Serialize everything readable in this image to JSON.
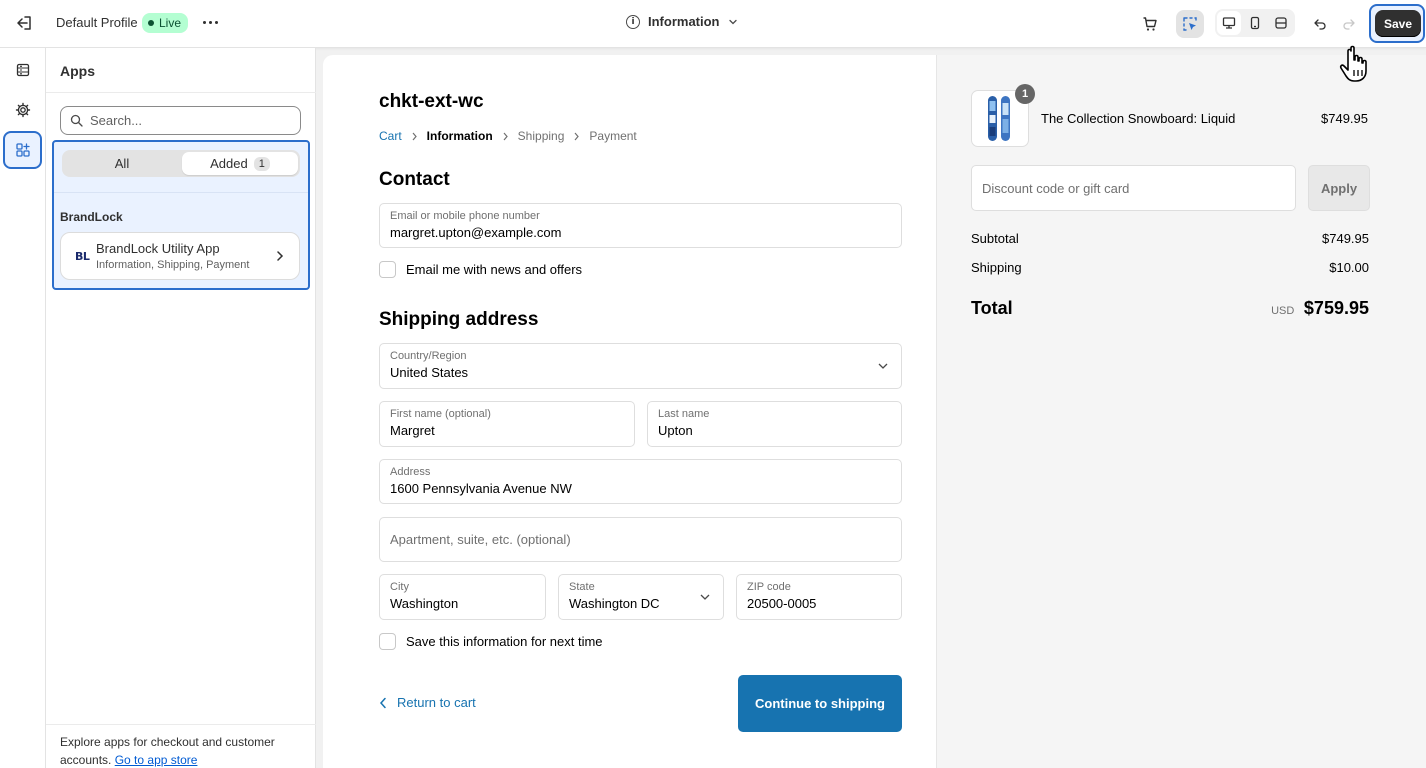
{
  "topbar": {
    "profile_name": "Default Profile",
    "status_badge": "Live",
    "page_selector": "Information",
    "save_label": "Save"
  },
  "panel": {
    "title": "Apps",
    "search_placeholder": "Search...",
    "tabs": [
      {
        "label": "All",
        "count": ""
      },
      {
        "label": "Added",
        "count": "1"
      }
    ],
    "group_label": "BrandLock",
    "app": {
      "logo_text": "BL",
      "name": "BrandLock Utility App",
      "targets": "Information, Shipping, Payment"
    },
    "footer_text": "Explore apps for checkout and customer accounts.",
    "footer_link": "Go to app store"
  },
  "checkout": {
    "shop_name": "chkt-ext-wc",
    "breadcrumbs": [
      "Cart",
      "Information",
      "Shipping",
      "Payment"
    ],
    "contact_heading": "Contact",
    "email": {
      "label": "Email or mobile phone number",
      "value": "margret.upton@example.com"
    },
    "news_checkbox": "Email me with news and offers",
    "shipping_heading": "Shipping address",
    "country": {
      "label": "Country/Region",
      "value": "United States"
    },
    "first_name": {
      "label": "First name (optional)",
      "value": "Margret"
    },
    "last_name": {
      "label": "Last name",
      "value": "Upton"
    },
    "address": {
      "label": "Address",
      "value": "1600 Pennsylvania Avenue NW"
    },
    "apartment_placeholder": "Apartment, suite, etc. (optional)",
    "city": {
      "label": "City",
      "value": "Washington"
    },
    "state": {
      "label": "State",
      "value": "Washington DC"
    },
    "zip": {
      "label": "ZIP code",
      "value": "20500-0005"
    },
    "save_info_checkbox": "Save this information for next time",
    "return_link": "Return to cart",
    "continue_button": "Continue to shipping"
  },
  "summary": {
    "quantity": "1",
    "product_name": "The Collection Snowboard: Liquid",
    "product_price": "$749.95",
    "discount_placeholder": "Discount code or gift card",
    "apply_label": "Apply",
    "subtotal_label": "Subtotal",
    "subtotal_value": "$749.95",
    "shipping_label": "Shipping",
    "shipping_value": "$10.00",
    "total_label": "Total",
    "currency": "USD",
    "total_value": "$759.95"
  },
  "colors": {
    "accent": "#2c6ecb",
    "checkout_primary": "#1773b0",
    "live_badge": "#b4fed2",
    "save_button": "#303030"
  },
  "icons": [
    "exit-icon",
    "more-icon",
    "info-icon",
    "chevron-down-icon",
    "cart-icon",
    "inspector-icon",
    "desktop-icon",
    "mobile-icon",
    "fullscreen-icon",
    "undo-icon",
    "redo-icon",
    "sections-icon",
    "settings-icon",
    "apps-icon",
    "search-icon",
    "chevron-right-icon",
    "chevron-left-icon",
    "pointer-cursor-icon"
  ]
}
